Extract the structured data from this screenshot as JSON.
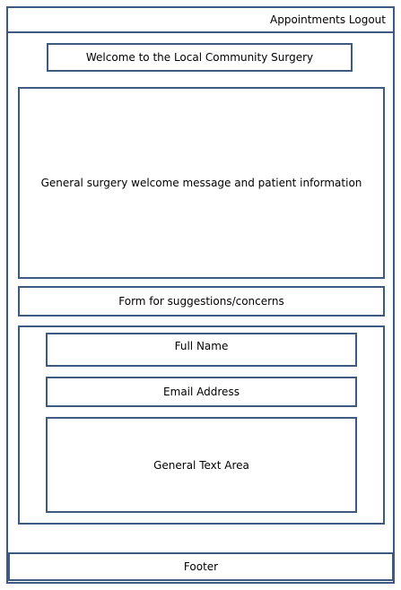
{
  "header": {
    "nav_appointments": "Appointments",
    "nav_logout": "Logout"
  },
  "welcome": {
    "title": "Welcome to the Local Community Surgery"
  },
  "info": {
    "text": "General surgery welcome message and patient information"
  },
  "form": {
    "heading": "Form for suggestions/concerns",
    "full_name_label": "Full Name",
    "email_label": "Email Address",
    "text_area_label": "General Text Area"
  },
  "footer": {
    "text": "Footer"
  },
  "colors": {
    "border": "#3d5a80",
    "background": "#ffffff",
    "text": "#000000"
  }
}
